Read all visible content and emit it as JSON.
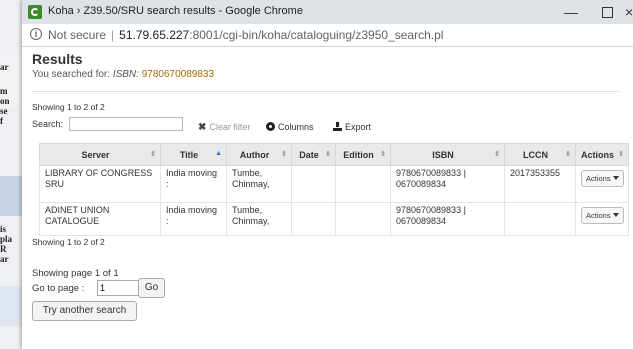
{
  "window": {
    "title": "Koha › Z39.50/SRU search results - Google Chrome",
    "minimize_glyph": "—",
    "close_glyph": "×"
  },
  "address_bar": {
    "security": "Not secure",
    "separator": "|",
    "host": "51.79.65.227",
    "path": ":8001/cgi-bin/koha/cataloguing/z3950_search.pl"
  },
  "background_fragments": [
    "ar",
    "m",
    "on",
    "se",
    "f",
    "is",
    "pla",
    "R",
    "ar"
  ],
  "page": {
    "heading": "Results",
    "searched_for_label": "You searched for:",
    "search_field": "ISBN:",
    "search_value": "9780670089833",
    "showing_top": "Showing 1 to 2 of 2",
    "showing_bottom": "Showing 1 to 2 of 2",
    "search_label": "Search:",
    "search_value_input": "",
    "clear_filter": "Clear filter",
    "columns": "Columns",
    "export": "Export"
  },
  "table": {
    "columns": [
      "Server",
      "Title",
      "Author",
      "Date",
      "Edition",
      "ISBN",
      "LCCN",
      "Actions"
    ],
    "rows": [
      {
        "server": "LIBRARY OF CONGRESS SRU",
        "title": "India moving :",
        "author": "Tumbe, Chinmay,",
        "date": "",
        "edition": "",
        "isbn": "9780670089833 | 0670089834",
        "lccn": "2017353355",
        "actions": "Actions"
      },
      {
        "server": "ADINET UNION CATALOGUE",
        "title": "India moving :",
        "author": "Tumbe, Chinmay,",
        "date": "",
        "edition": "",
        "isbn": "9780670089833 | 0670089834",
        "lccn": "",
        "actions": "Actions"
      }
    ]
  },
  "pagination": {
    "summary": "Showing page 1 of 1",
    "goto_label": "Go to page :",
    "goto_value": "1",
    "go_button": "Go",
    "try_again": "Try another search"
  },
  "colors": {
    "isbn_highlight": "#a86a00",
    "header_bg": "#e9e9e9",
    "titlebar": "#dee1e6"
  }
}
